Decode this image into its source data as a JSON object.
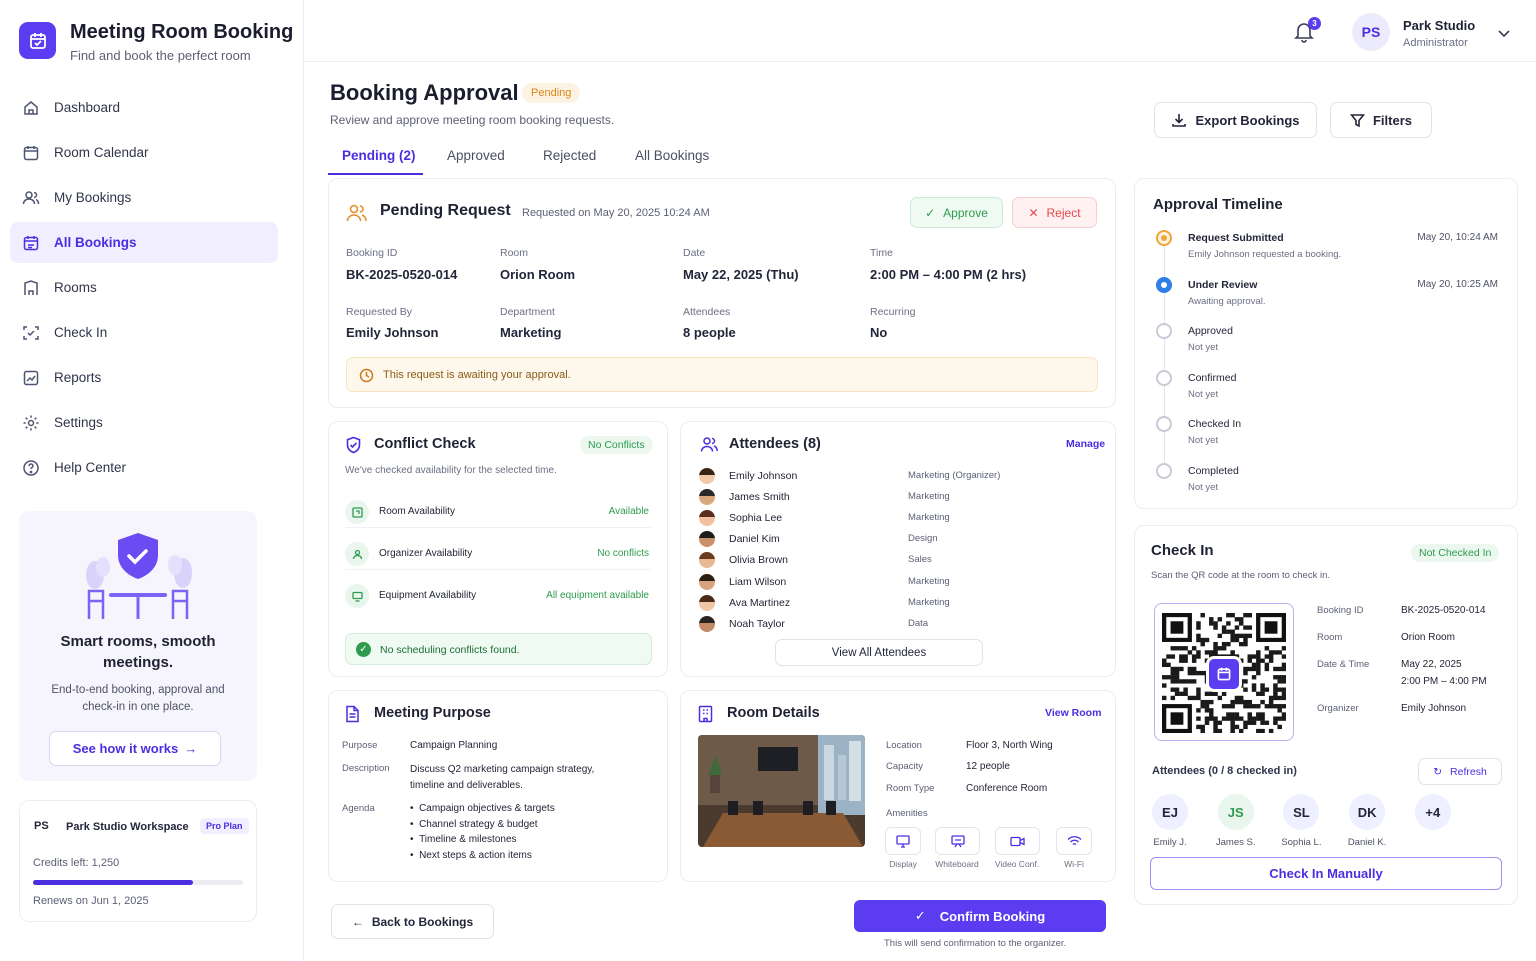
{
  "app": {
    "title": "Meeting Room Booking",
    "subtitle": "Find and book the perfect room"
  },
  "sidebar": {
    "items": [
      {
        "label": "Dashboard",
        "icon": "home-icon"
      },
      {
        "label": "Room Calendar",
        "icon": "calendar-icon"
      },
      {
        "label": "My Bookings",
        "icon": "users-icon"
      },
      {
        "label": "All Bookings",
        "icon": "calendar-check-icon",
        "active": true
      },
      {
        "label": "Rooms",
        "icon": "building-icon"
      },
      {
        "label": "Check In",
        "icon": "scan-icon"
      },
      {
        "label": "Reports",
        "icon": "chart-icon"
      },
      {
        "label": "Settings",
        "icon": "gear-icon"
      },
      {
        "label": "Help Center",
        "icon": "help-icon"
      }
    ],
    "promo": {
      "title": "Smart rooms, smooth meetings.",
      "description": "End-to-end booking, approval and check-in in one place.",
      "button": "See how it works"
    },
    "workspace": {
      "initials": "PS",
      "name": "Park Studio Workspace",
      "plan": "Pro Plan",
      "credits": "Credits left: 1,250",
      "credits_fraction": 0.8,
      "renews": "Renews on Jun 1, 2025"
    }
  },
  "topbar": {
    "notifications": "3",
    "user_initials": "PS",
    "user_name": "Park Studio",
    "user_role": "Administrator"
  },
  "page": {
    "title": "Booking Approval",
    "status_badge": "Pending",
    "subtitle": "Review and approve meeting room booking requests.",
    "export_label": "Export Bookings",
    "filters_label": "Filters",
    "tabs": [
      "Pending (2)",
      "Approved",
      "Rejected",
      "All Bookings"
    ]
  },
  "request": {
    "title": "Pending Request",
    "requested_on": "Requested on May 20, 2025  10:24 AM",
    "approve": "Approve",
    "reject": "Reject",
    "fields": [
      {
        "label": "Booking ID",
        "value": "BK-2025-0520-014"
      },
      {
        "label": "Room",
        "value": "Orion Room"
      },
      {
        "label": "Date",
        "value": "May 22, 2025 (Thu)"
      },
      {
        "label": "Time",
        "value": "2:00 PM – 4:00 PM (2 hrs)"
      },
      {
        "label": "Requested By",
        "value": "Emily Johnson"
      },
      {
        "label": "Department",
        "value": "Marketing"
      },
      {
        "label": "Attendees",
        "value": "8 people"
      },
      {
        "label": "Recurring",
        "value": "No"
      }
    ],
    "notice": "This request is awaiting your approval."
  },
  "conflict": {
    "title": "Conflict Check",
    "badge": "No Conflicts",
    "subtitle": "We've checked availability for the selected time.",
    "rows": [
      {
        "label": "Room Availability",
        "status": "Available"
      },
      {
        "label": "Organizer Availability",
        "status": "No conflicts"
      },
      {
        "label": "Equipment Availability",
        "status": "All equipment available"
      }
    ],
    "result": "No scheduling conflicts found."
  },
  "attendees": {
    "title": "Attendees (8)",
    "manage": "Manage",
    "list": [
      {
        "name": "Emily Johnson",
        "dept": "Marketing (Organizer)"
      },
      {
        "name": "James Smith",
        "dept": "Marketing"
      },
      {
        "name": "Sophia Lee",
        "dept": "Marketing"
      },
      {
        "name": "Daniel Kim",
        "dept": "Design"
      },
      {
        "name": "Olivia Brown",
        "dept": "Sales"
      },
      {
        "name": "Liam Wilson",
        "dept": "Marketing"
      },
      {
        "name": "Ava Martinez",
        "dept": "Marketing"
      },
      {
        "name": "Noah Taylor",
        "dept": "Data"
      }
    ],
    "view_all": "View All Attendees"
  },
  "purpose": {
    "title": "Meeting Purpose",
    "purpose_label": "Purpose",
    "purpose_value": "Campaign Planning",
    "description_label": "Description",
    "description_value": "Discuss Q2 marketing campaign strategy, timeline and deliverables.",
    "agenda_label": "Agenda",
    "agenda": [
      "Campaign objectives & targets",
      "Channel strategy & budget",
      "Timeline & milestones",
      "Next steps & action items"
    ]
  },
  "room": {
    "title": "Room Details",
    "view_room": "View Room",
    "fields": [
      {
        "label": "Location",
        "value": "Floor 3, North Wing"
      },
      {
        "label": "Capacity",
        "value": "12 people"
      },
      {
        "label": "Room Type",
        "value": "Conference Room"
      }
    ],
    "amenities_label": "Amenities",
    "amenities": [
      "Display",
      "Whiteboard",
      "Video Conf.",
      "Wi-Fi"
    ]
  },
  "timeline": {
    "title": "Approval Timeline",
    "steps": [
      {
        "title": "Request Submitted",
        "sub": "Emily Johnson requested a booking.",
        "time": "May 20, 10:24 AM",
        "state": "done"
      },
      {
        "title": "Under Review",
        "sub": "Awaiting approval.",
        "time": "May 20, 10:25 AM",
        "state": "current"
      },
      {
        "title": "Approved",
        "sub": "Not yet",
        "time": "",
        "state": "todo"
      },
      {
        "title": "Confirmed",
        "sub": "Not yet",
        "time": "",
        "state": "todo"
      },
      {
        "title": "Checked In",
        "sub": "Not yet",
        "time": "",
        "state": "todo"
      },
      {
        "title": "Completed",
        "sub": "Not yet",
        "time": "",
        "state": "todo"
      }
    ]
  },
  "checkin": {
    "title": "Check In",
    "badge": "Not Checked In",
    "subtitle": "Scan the QR code at the room to check in.",
    "fields": [
      {
        "label": "Booking ID",
        "value": "BK-2025-0520-014"
      },
      {
        "label": "Room",
        "value": "Orion Room"
      },
      {
        "label": "Date & Time",
        "value": "May 22, 2025",
        "value2": "2:00 PM – 4:00 PM"
      },
      {
        "label": "Organizer",
        "value": "Emily Johnson"
      }
    ],
    "attendees_label": "Attendees (0 / 8 checked in)",
    "refresh": "Refresh",
    "avatars": [
      {
        "initials": "EJ",
        "name": "Emily J."
      },
      {
        "initials": "JS",
        "name": "James S."
      },
      {
        "initials": "SL",
        "name": "Sophia L."
      },
      {
        "initials": "DK",
        "name": "Daniel K."
      },
      {
        "initials": "+4",
        "name": ""
      }
    ],
    "manual": "Check In Manually"
  },
  "footer": {
    "back": "Back to Bookings",
    "confirm": "Confirm Booking",
    "confirm_note": "This will send confirmation to the organizer."
  },
  "colors": {
    "primary": "#5b3cf0",
    "success": "#2e9b4e",
    "danger": "#e5484d",
    "warning": "#e5902b"
  }
}
